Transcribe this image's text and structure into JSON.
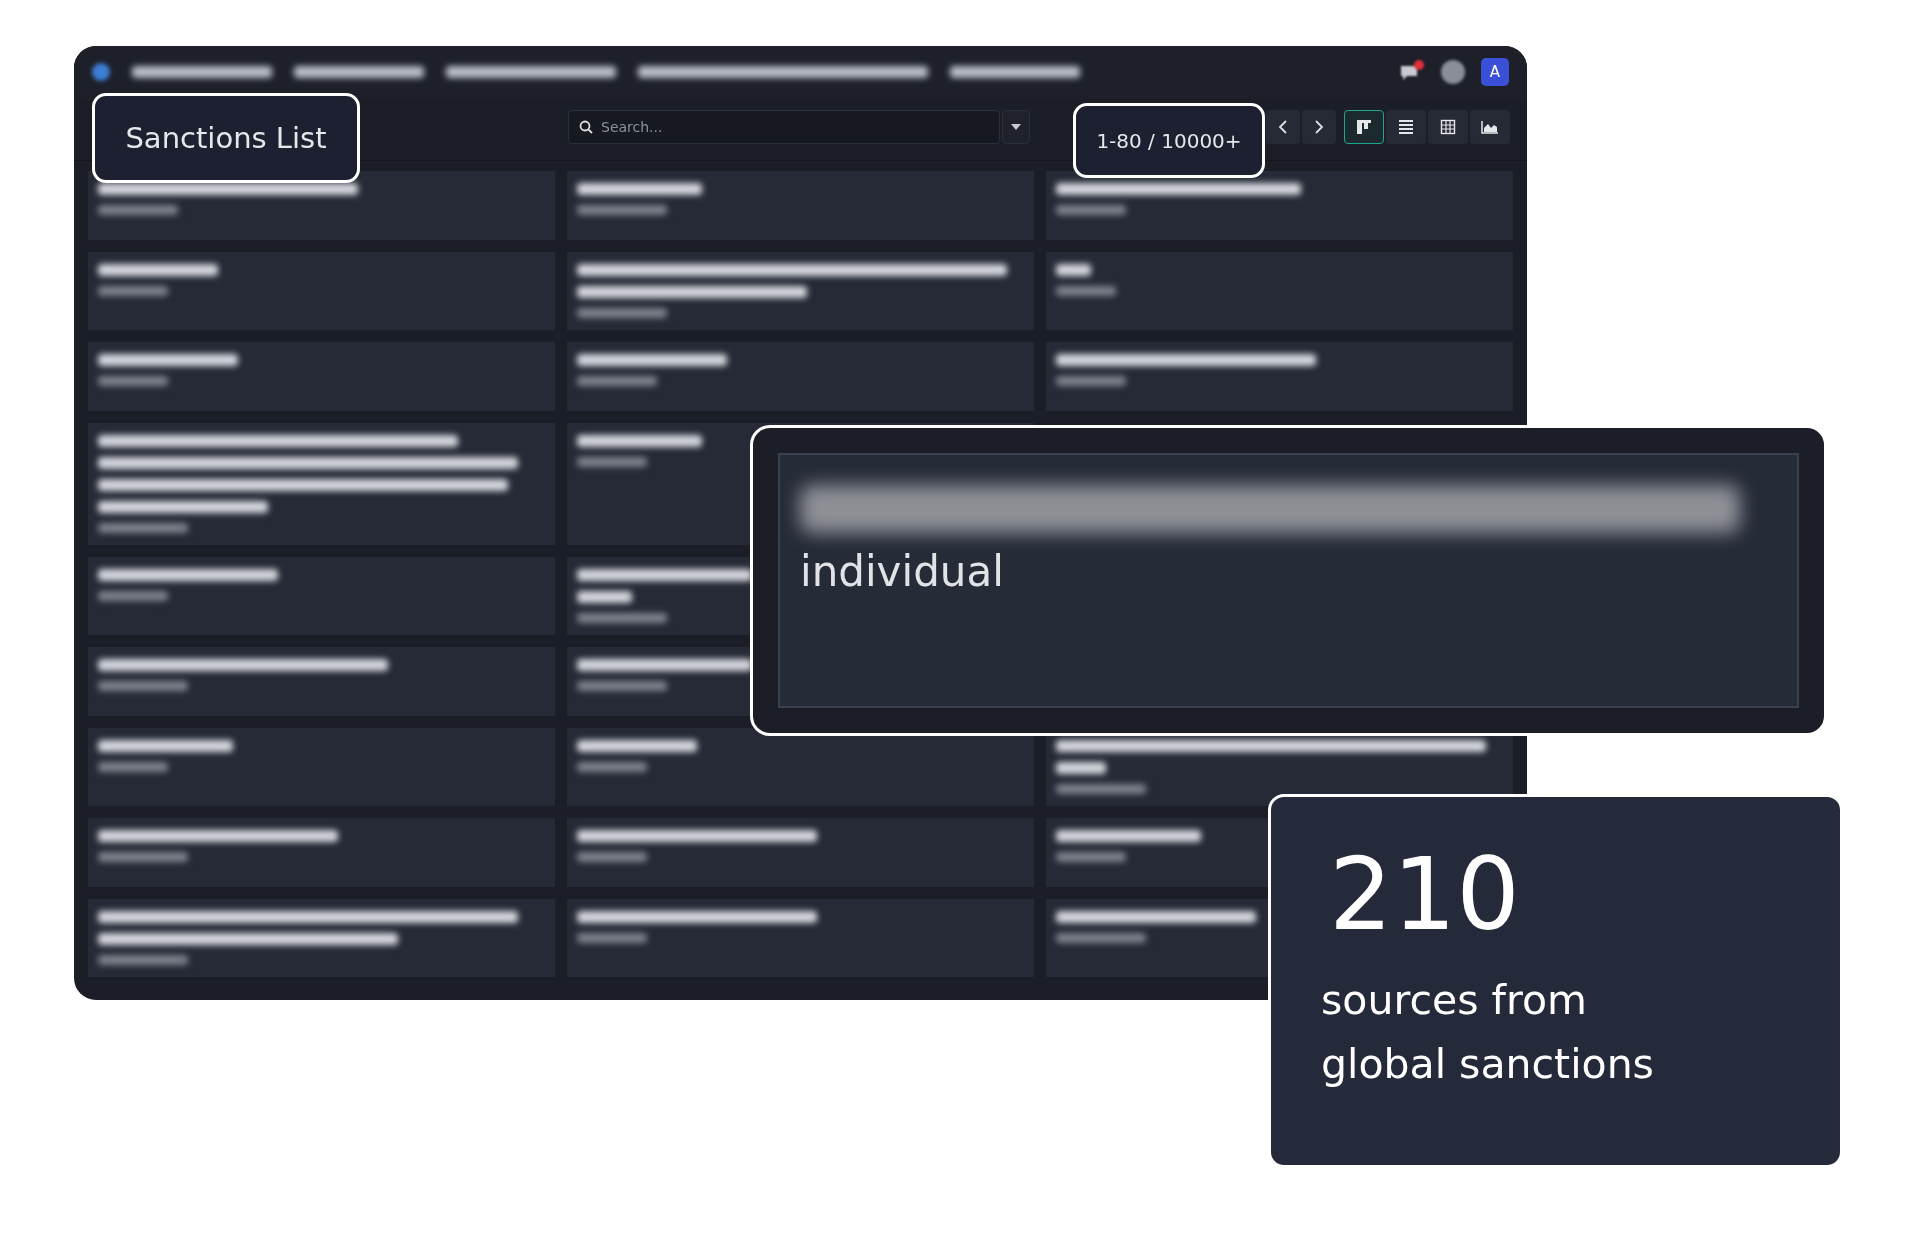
{
  "navbar": {
    "avatar": "A"
  },
  "header": {
    "title": "Sanctions List"
  },
  "search": {
    "placeholder": "Search..."
  },
  "pager": "1-80 / 10000+",
  "views": [
    {
      "kind": "kanban",
      "selected": true
    },
    {
      "kind": "list",
      "selected": false
    },
    {
      "kind": "table",
      "selected": false
    },
    {
      "kind": "graph",
      "selected": false
    }
  ],
  "detail": {
    "type_label": "individual"
  },
  "stat": {
    "value": "210",
    "caption": "sources from global sanctions"
  }
}
